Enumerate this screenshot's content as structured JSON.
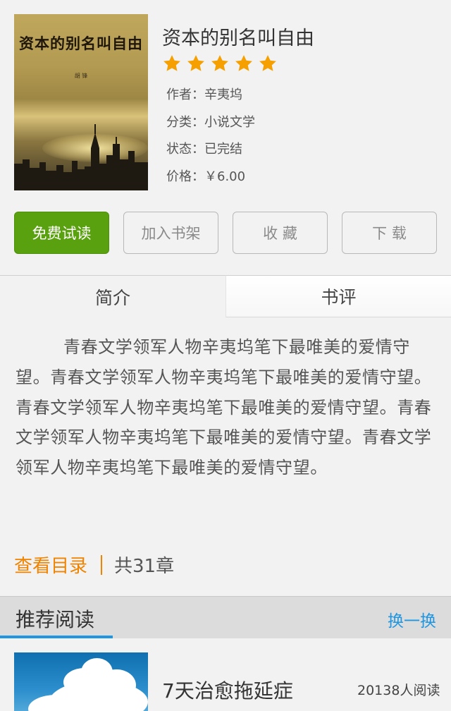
{
  "book": {
    "cover_title": "资本的别名叫自由",
    "cover_author": "胡 锋",
    "title": "资本的别名叫自由",
    "rating": 5,
    "rating_max": 5,
    "star_color": "#f5a000",
    "author_label": "作者：",
    "author": "辛夷坞",
    "category_label": "分类：",
    "category": "小说文学",
    "status_label": "状态：",
    "status": "已完结",
    "price_label": "价格：",
    "price": "￥6.00"
  },
  "actions": {
    "free_read": "免费试读",
    "add_shelf": "加入书架",
    "favorite": "收 藏",
    "download": "下 载"
  },
  "tabs": {
    "intro": "简介",
    "review": "书评"
  },
  "intro_text": "青春文学领军人物辛夷坞笔下最唯美的爱情守望。青春文学领军人物辛夷坞笔下最唯美的爱情守望。青春文学领军人物辛夷坞笔下最唯美的爱情守望。青春文学领军人物辛夷坞笔下最唯美的爱情守望。青春文学领军人物辛夷坞笔下最唯美的爱情守望。",
  "catalog": {
    "link": "查看目录",
    "chapters": "共31章"
  },
  "recommend": {
    "title": "推荐阅读",
    "switch": "换一换",
    "items": [
      {
        "title": "7天治愈拖延症",
        "readers": "20138人阅读"
      }
    ]
  },
  "colors": {
    "primary_green": "#5aa10f",
    "link_orange": "#f08300",
    "accent_blue": "#2196e0"
  }
}
